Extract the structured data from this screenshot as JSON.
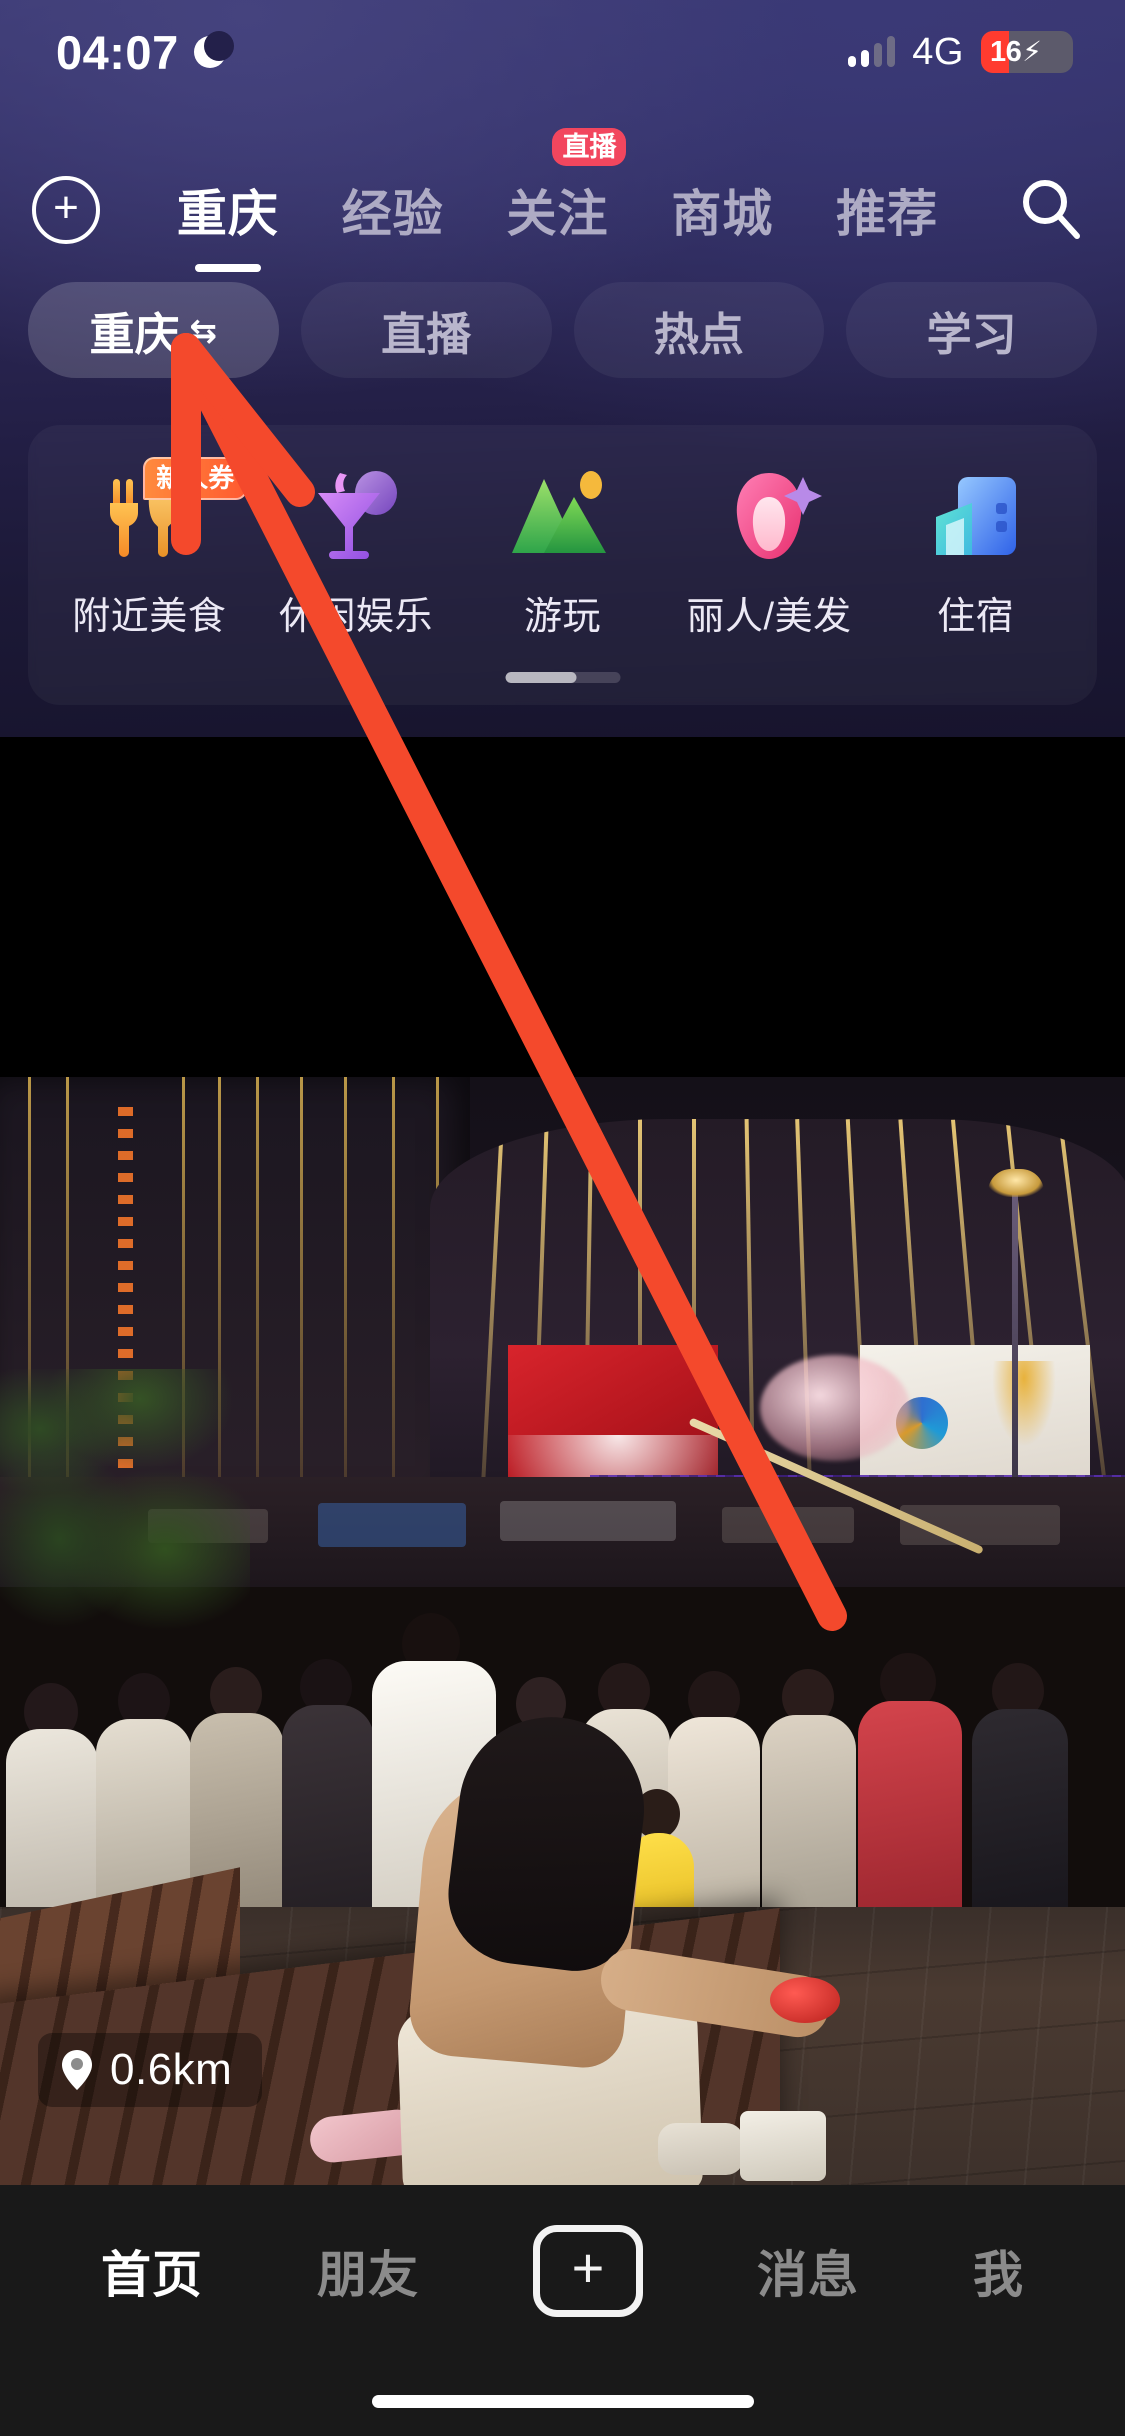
{
  "status_bar": {
    "time": "04:07",
    "moon_icon": "moon-icon",
    "signal_icon": "signal-bars-icon",
    "network": "4G",
    "battery_percent": "16",
    "battery_charging_icon": "lightning-bolt-icon",
    "battery_level": 16,
    "battery_color": "#ff3b2f"
  },
  "header": {
    "add_button": "+",
    "tabs": [
      {
        "label": "重庆",
        "active": true,
        "badge": ""
      },
      {
        "label": "经验",
        "active": false,
        "badge": ""
      },
      {
        "label": "关注",
        "active": false,
        "badge": "直播"
      },
      {
        "label": "商城",
        "active": false,
        "badge": ""
      },
      {
        "label": "推荐",
        "active": false,
        "badge": ""
      }
    ],
    "search_icon": "search-icon",
    "active_tab_color": "#ffffff",
    "inactive_tab_color": "#aeabc4",
    "badge_color": "#f2465e"
  },
  "filter_pills": [
    {
      "label": "重庆",
      "suffix": "⇆",
      "active": true
    },
    {
      "label": "直播",
      "suffix": "",
      "active": false
    },
    {
      "label": "热点",
      "suffix": "",
      "active": false
    },
    {
      "label": "学习",
      "suffix": "",
      "active": false
    }
  ],
  "categories": {
    "items": [
      {
        "label": "附近美食",
        "icon": "fork-knife-icon",
        "badge": "新人券"
      },
      {
        "label": "休闲娱乐",
        "icon": "cocktail-glass-icon",
        "badge": ""
      },
      {
        "label": "游玩",
        "icon": "mountain-sun-icon",
        "badge": ""
      },
      {
        "label": "丽人/美发",
        "icon": "beauty-sparkle-icon",
        "badge": ""
      },
      {
        "label": "住宿",
        "icon": "hotel-buildings-icon",
        "badge": ""
      }
    ],
    "scroll_position": 0.6
  },
  "media": {
    "distance": "0.6km",
    "location_icon": "location-pin-icon",
    "scene": "night street performance with crowd"
  },
  "annotation": {
    "arrow_icon": "red-arrow-annotation",
    "color": "#f4492c",
    "points_to": "重庆"
  },
  "bottom_nav": {
    "items": [
      {
        "label": "首页",
        "active": true,
        "type": "text"
      },
      {
        "label": "朋友",
        "active": false,
        "type": "text"
      },
      {
        "label": "+",
        "active": false,
        "type": "plus-button"
      },
      {
        "label": "消息",
        "active": false,
        "type": "text"
      },
      {
        "label": "我",
        "active": false,
        "type": "text"
      }
    ],
    "home_indicator": "home-indicator"
  }
}
